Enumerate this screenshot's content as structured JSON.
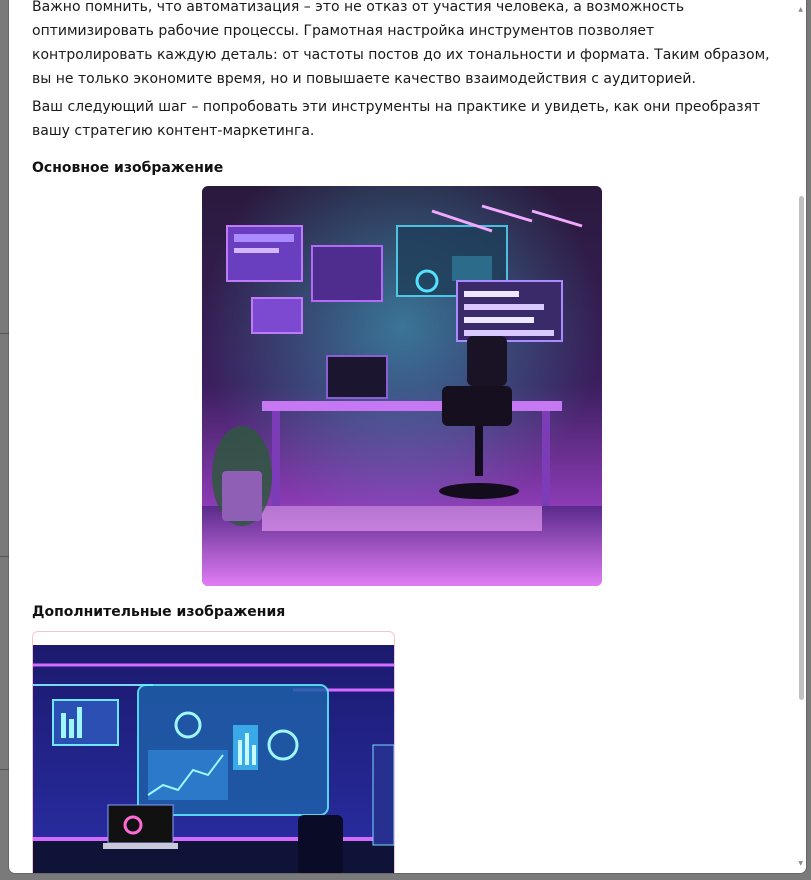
{
  "article": {
    "paragraph1": "Важно помнить, что автоматизация – это не отказ от участия человека, а возможность оптимизировать рабочие процессы. Грамотная настройка инструментов позволяет контролировать каждую деталь: от частоты постов до их тональности и формата. Таким образом, вы не только экономите время, но и повышаете качество взаимодействия с аудиторией.",
    "paragraph2": "Ваш следующий шаг – попробовать эти инструменты на практике и увидеть, как они преобразят вашу стратегию контент-маркетинга."
  },
  "images": {
    "main_title": "Основное изображение",
    "extra_title": "Дополнительные изображения",
    "main_image_icon": "neon-office-illustration",
    "extra_image_icon": "neon-dashboard-illustration"
  },
  "colors": {
    "accent_purple": "#b24bf3",
    "card_border": "#f3c6cf",
    "overlay": "#7a7a7a"
  }
}
